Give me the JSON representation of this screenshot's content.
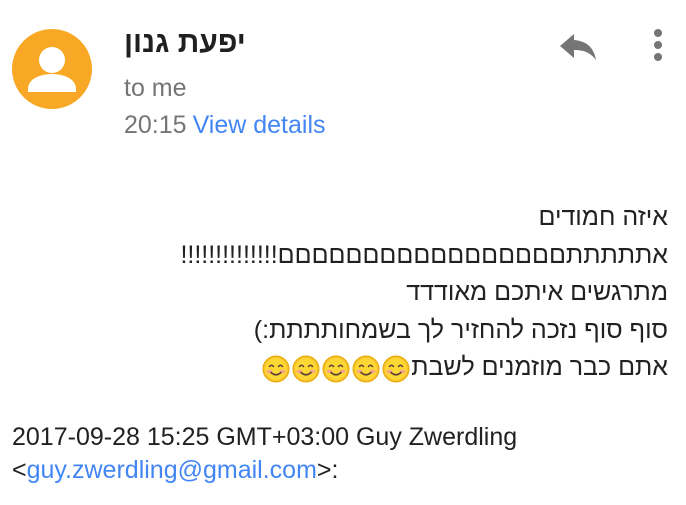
{
  "sender": {
    "name": "יפעת גנון",
    "avatar_color": "#f9a825",
    "recipient": "to me",
    "time": "20:15",
    "view_details_label": "View details"
  },
  "actions": {
    "reply_icon": "reply-icon",
    "more_icon": "more-vert-icon"
  },
  "message": {
    "lines": [
      "איזה חמודים",
      "אתתתתתםםםםםםםםםםםםםםםםם!!!!!!!!!!!!!!",
      "מתרגשים איתכם מאודדד",
      "סוף סוף נזכה להחזיר לך בשמחותתתת:)",
      "אתם כבר מוזמנים לשבת"
    ],
    "emoji_icon": "smiling-face-icon",
    "emoji_count": 5
  },
  "quote": {
    "header": "2017-09-28 15:25 GMT+03:00 Guy Zwerdling",
    "lt": "<",
    "email": "guy.zwerdling@gmail.com",
    "gt_colon": ">:"
  },
  "colors": {
    "link": "#4285f4",
    "secondary_text": "#757575",
    "icon_gray": "#757575"
  }
}
